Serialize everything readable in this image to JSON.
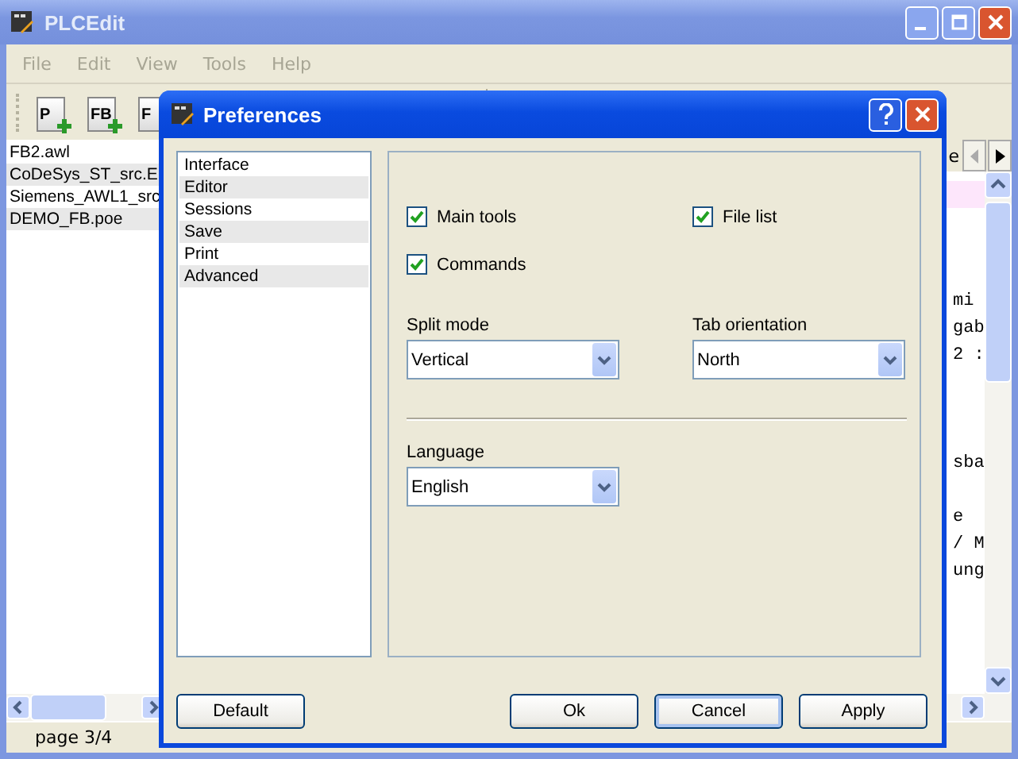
{
  "app": {
    "title": "PLCEdit",
    "menu": [
      {
        "label": "File",
        "disabled": true
      },
      {
        "label": "Edit",
        "disabled": true
      },
      {
        "label": "View",
        "disabled": true
      },
      {
        "label": "Tools",
        "disabled": true
      },
      {
        "label": "Help",
        "disabled": true
      }
    ],
    "toolbar": [
      {
        "label": "P"
      },
      {
        "label": "FB"
      },
      {
        "label": "F"
      }
    ],
    "files": [
      {
        "name": "FB2.awl"
      },
      {
        "name": "CoDeSys_ST_src.E"
      },
      {
        "name": "Siemens_AWL1_src"
      },
      {
        "name": "DEMO_FB.poe"
      }
    ],
    "editor": {
      "tab": "e",
      "lines": [
        {
          "highlighted": true
        },
        {
          "highlighted": false
        },
        {
          "highlighted": false
        },
        {
          "highlighted": false
        },
        {
          "highlighted": false,
          "text": "mi"
        },
        {
          "highlighted": false,
          "text": "gab"
        },
        {
          "highlighted": false,
          "text": "2 :"
        },
        {
          "highlighted": false
        },
        {
          "highlighted": false
        },
        {
          "highlighted": false
        },
        {
          "highlighted": false,
          "text": "sba"
        },
        {
          "highlighted": false
        },
        {
          "highlighted": false,
          "text": "e"
        },
        {
          "highlighted": false,
          "text": "/ M"
        },
        {
          "highlighted": false,
          "text": "ung"
        }
      ]
    },
    "status_bar": {
      "page": "page 3/4"
    }
  },
  "dialog": {
    "title": "Preferences",
    "categories": [
      {
        "label": "Interface"
      },
      {
        "label": "Editor"
      },
      {
        "label": "Sessions"
      },
      {
        "label": "Save"
      },
      {
        "label": "Print"
      },
      {
        "label": "Advanced"
      }
    ],
    "checkboxes": [
      {
        "label": "Main tools",
        "checked": true
      },
      {
        "label": "File list",
        "checked": true
      },
      {
        "label": "Commands",
        "checked": true
      }
    ],
    "split_mode": {
      "label": "Split mode",
      "value": "Vertical"
    },
    "tab_orientation": {
      "label": "Tab orientation",
      "value": "North"
    },
    "language": {
      "label": "Language",
      "value": "English"
    },
    "buttons": [
      {
        "label": "Default",
        "focused": false
      },
      {
        "label": "Ok",
        "focused": false
      },
      {
        "label": "Cancel",
        "focused": true
      },
      {
        "label": "Apply",
        "focused": false
      }
    ]
  }
}
